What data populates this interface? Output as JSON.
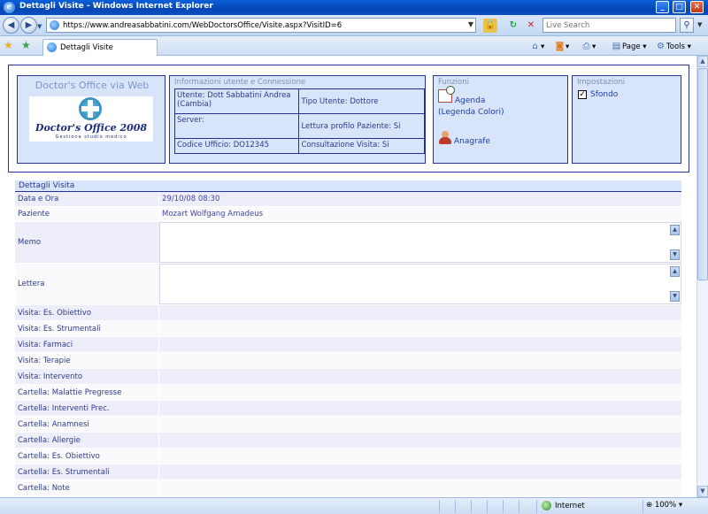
{
  "window": {
    "title": "Dettagli Visite - Windows Internet Explorer"
  },
  "browser": {
    "url": "https://www.andreasabbatini.com/WebDoctorsOffice/Visite.aspx?VisitID=6",
    "search_placeholder": "Live Search",
    "tab_label": "Dettagli Visite",
    "tools": {
      "page": "Page",
      "tools": "Tools"
    },
    "status_zone": "Internet",
    "zoom": "100%"
  },
  "header": {
    "brand": {
      "title": "Doctor's Office via Web",
      "logo_text": "Doctor's Office 2008",
      "logo_subtitle": "Gestione studio medico"
    },
    "info": {
      "title": "Informazioni utente e Connessione",
      "utente": "Utente: Dott Sabbatini Andrea (Cambia)",
      "tipo_utente": "Tipo Utente: Dottore",
      "server": "Server:",
      "lettura_profilo": "Lettura profilo Paziente: Si",
      "codice_ufficio": "Codice Ufficio: DO12345",
      "consultazione": "Consultazione Visita: Si"
    },
    "funzioni": {
      "title": "Funzioni",
      "agenda": "Agenda",
      "legenda": "(Legenda Colori)",
      "anagrafe": "Anagrafe"
    },
    "impostazioni": {
      "title": "Impostazioni",
      "sfondo": "Sfondo",
      "sfondo_checked": true
    }
  },
  "details": {
    "title": "Dettagli Visita",
    "rows": [
      {
        "label": "Data e Ora",
        "value": "29/10/08 08:30"
      },
      {
        "label": "Paziente",
        "value": "Mozart Wolfgang Amadeus"
      },
      {
        "label": "Memo",
        "value": ""
      },
      {
        "label": "Lettera",
        "value": ""
      },
      {
        "label": "Visita: Es. Obiettivo",
        "value": ""
      },
      {
        "label": "Visita: Es. Strumentali",
        "value": ""
      },
      {
        "label": "Visita: Farmaci",
        "value": ""
      },
      {
        "label": "Visita: Terapie",
        "value": ""
      },
      {
        "label": "Visita: Intervento",
        "value": ""
      },
      {
        "label": "Cartella: Malattie Pregresse",
        "value": ""
      },
      {
        "label": "Cartella: Interventi Prec.",
        "value": ""
      },
      {
        "label": "Cartella: Anamnesi",
        "value": ""
      },
      {
        "label": "Cartella: Allergie",
        "value": ""
      },
      {
        "label": "Cartella: Es. Obiettivo",
        "value": ""
      },
      {
        "label": "Cartella: Es. Strumentali",
        "value": ""
      },
      {
        "label": "Cartella: Note",
        "value": ""
      }
    ]
  },
  "icons": {
    "back": "back-arrow-icon",
    "forward": "forward-arrow-icon",
    "lock": "lock-icon",
    "refresh": "refresh-icon",
    "stop": "stop-icon",
    "search": "magnifier-icon",
    "home": "home-icon",
    "feeds": "feeds-icon",
    "print": "printer-icon"
  }
}
